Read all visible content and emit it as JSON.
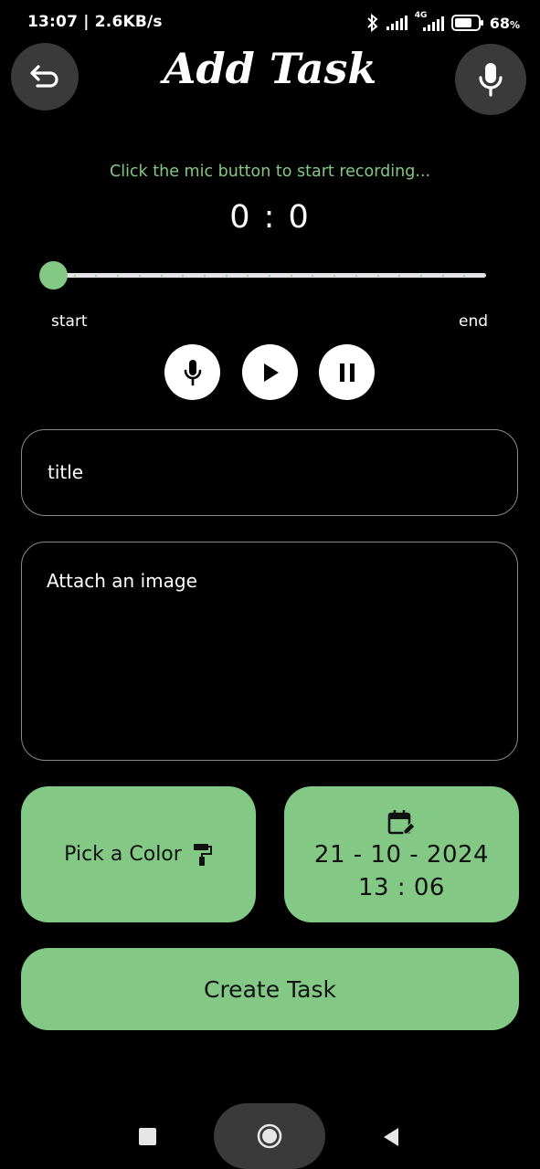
{
  "status_bar": {
    "time_speed": "13:07 | 2.6KB/s",
    "network_label": "4G",
    "battery_percent": "68",
    "percent_sign": "%"
  },
  "header": {
    "title": "Add Task"
  },
  "recorder": {
    "hint": "Click the mic button to start recording...",
    "timer": "0 : 0",
    "slider_position": 0,
    "start_label": "start",
    "end_label": "end"
  },
  "form": {
    "title_placeholder": "title",
    "image_placeholder": "Attach an image",
    "pick_color_label": "Pick a Color",
    "date": "21 - 10 - 2024",
    "time": "13 : 06",
    "create_label": "Create Task"
  },
  "colors": {
    "accent": "#83c985",
    "background": "#000000",
    "circle_button": "#3a3a3a"
  },
  "icons": [
    "undo-icon",
    "mic-icon",
    "play-icon",
    "pause-icon",
    "paint-roller-icon",
    "calendar-edit-icon",
    "bluetooth-icon",
    "signal-icon",
    "battery-icon"
  ]
}
